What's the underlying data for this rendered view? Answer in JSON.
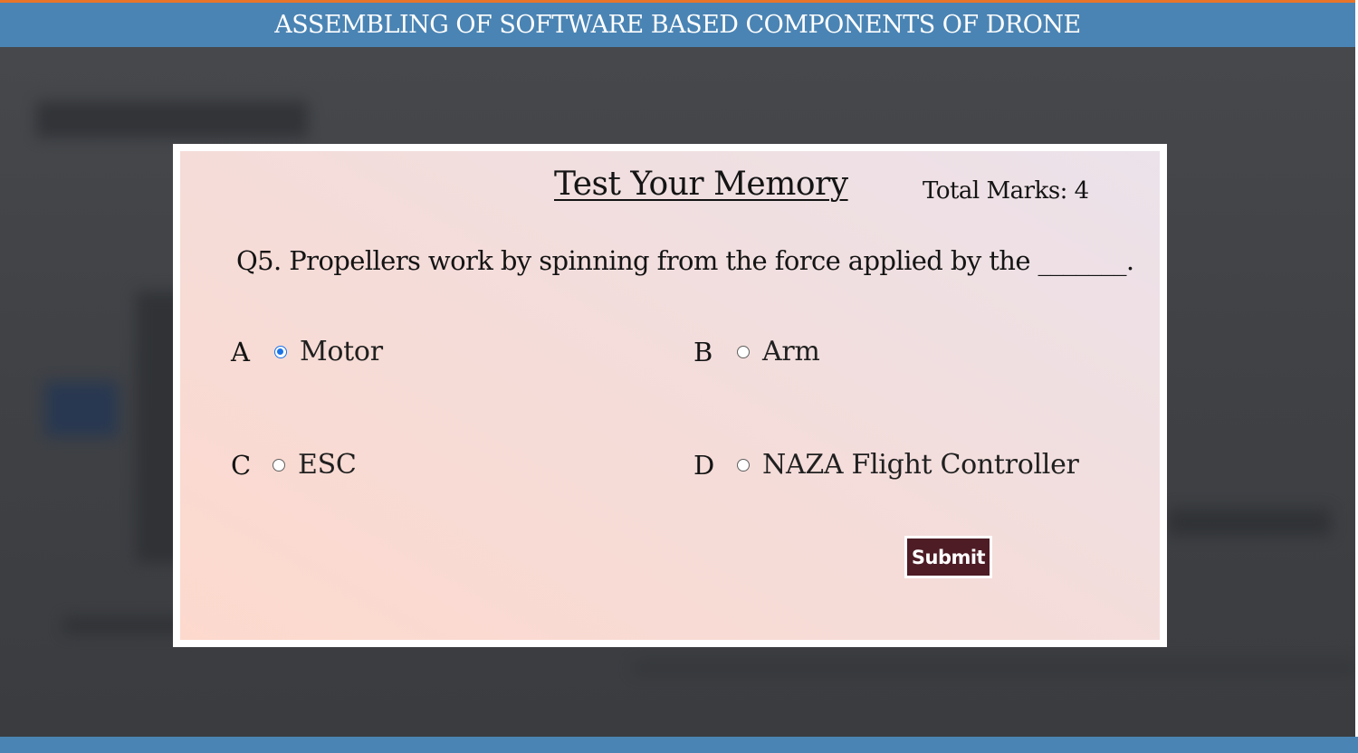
{
  "header": {
    "title": "ASSEMBLING OF SOFTWARE BASED COMPONENTS OF DRONE"
  },
  "quiz": {
    "title": "Test Your Memory",
    "total_marks_label": "Total Marks: 4",
    "question": "Q5. Propellers work by spinning from the force applied by the _______.",
    "options": [
      {
        "letter": "A",
        "text": "Motor",
        "selected": true
      },
      {
        "letter": "B",
        "text": "Arm",
        "selected": false
      },
      {
        "letter": "C",
        "text": "ESC",
        "selected": false
      },
      {
        "letter": "D",
        "text": "NAZA Flight Controller",
        "selected": false
      }
    ],
    "submit_label": "Submit"
  },
  "colors": {
    "header_bg": "#4a84b4",
    "accent_top": "#e8742a",
    "submit_bg": "#4d1c25",
    "radio_selected": "#1a73e8"
  }
}
